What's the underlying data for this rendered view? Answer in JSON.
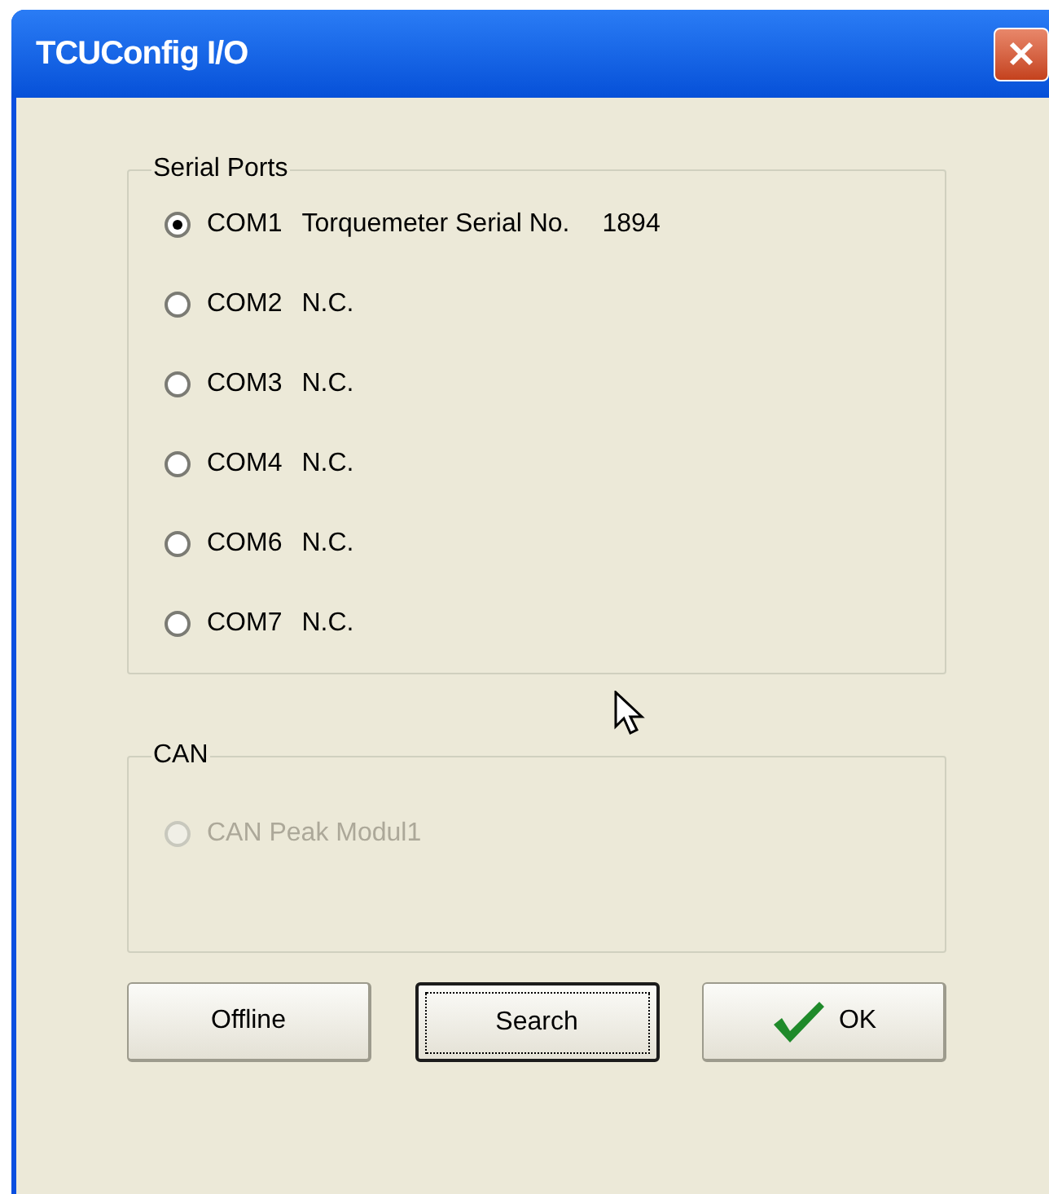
{
  "window": {
    "title": "TCUConfig I/O"
  },
  "serial_ports": {
    "title": "Serial Ports",
    "ports": [
      {
        "port": "COM1",
        "description": "Torquemeter Serial No.",
        "serial": "1894",
        "selected": true,
        "disabled": false
      },
      {
        "port": "COM2",
        "description": "N.C.",
        "selected": false,
        "disabled": false
      },
      {
        "port": "COM3",
        "description": "N.C.",
        "selected": false,
        "disabled": false
      },
      {
        "port": "COM4",
        "description": "N.C.",
        "selected": false,
        "disabled": false
      },
      {
        "port": "COM6",
        "description": "N.C.",
        "selected": false,
        "disabled": false
      },
      {
        "port": "COM7",
        "description": "N.C.",
        "selected": false,
        "disabled": false
      }
    ]
  },
  "can": {
    "title": "CAN",
    "modules": [
      {
        "label": "CAN Peak Modul1",
        "selected": false,
        "disabled": true
      }
    ]
  },
  "buttons": [
    {
      "label": "Offline",
      "kind": "plain",
      "focused": false
    },
    {
      "label": "Search",
      "kind": "plain",
      "focused": true
    },
    {
      "label": "OK",
      "kind": "ok",
      "focused": false
    }
  ]
}
